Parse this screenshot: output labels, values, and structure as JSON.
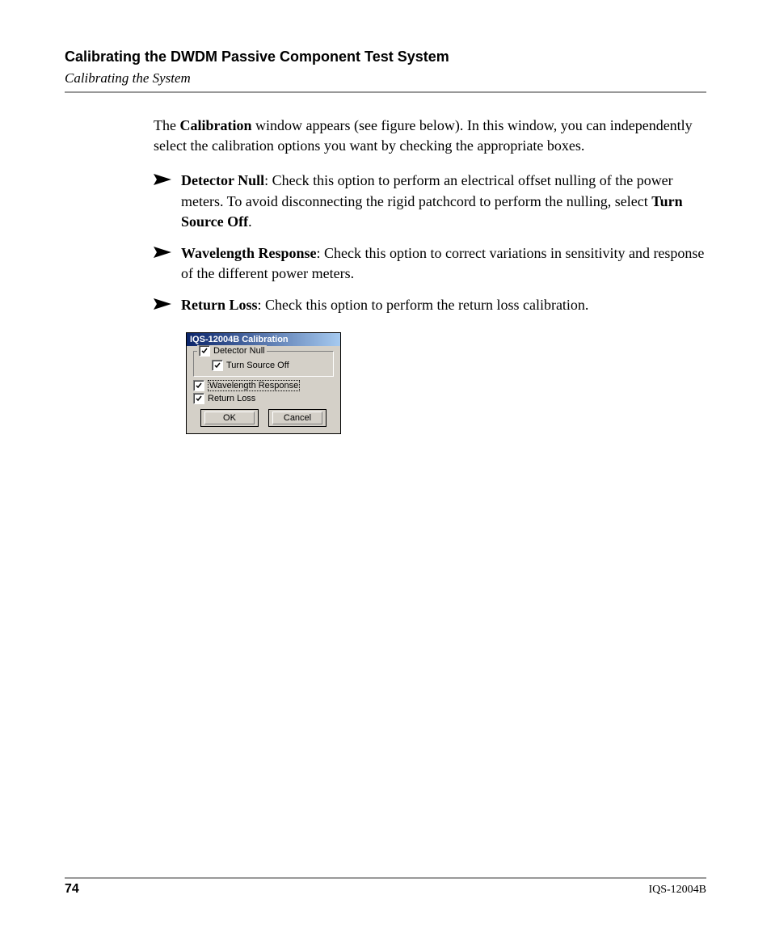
{
  "header": {
    "chapter": "Calibrating the DWDM Passive Component Test System",
    "section": "Calibrating the System"
  },
  "intro": {
    "pre": "The ",
    "bold1": "Calibration",
    "post": " window appears (see figure below). In this window, you can independently select the calibration options you want by checking the appropriate boxes."
  },
  "bullets": [
    {
      "term": "Detector Null",
      "text_before_bold": ": Check this option to perform an electrical offset nulling of the power meters. To avoid disconnecting the rigid patchcord to perform the nulling, select ",
      "bold_tail": "Turn Source Off",
      "text_after_bold": "."
    },
    {
      "term": "Wavelength Response",
      "text_before_bold": ": Check this option to correct variations in sensitivity and response of the different power meters.",
      "bold_tail": "",
      "text_after_bold": ""
    },
    {
      "term": "Return Loss",
      "text_before_bold": ": Check this option to perform the return loss calibration.",
      "bold_tail": "",
      "text_after_bold": ""
    }
  ],
  "dialog": {
    "title": "IQS-12004B Calibration",
    "detector_null": "Detector Null",
    "turn_source_off": "Turn Source Off",
    "wavelength_response": "Wavelength Response",
    "return_loss": "Return Loss",
    "ok": "OK",
    "cancel": "Cancel"
  },
  "footer": {
    "page": "74",
    "doc_id": "IQS-12004B"
  }
}
